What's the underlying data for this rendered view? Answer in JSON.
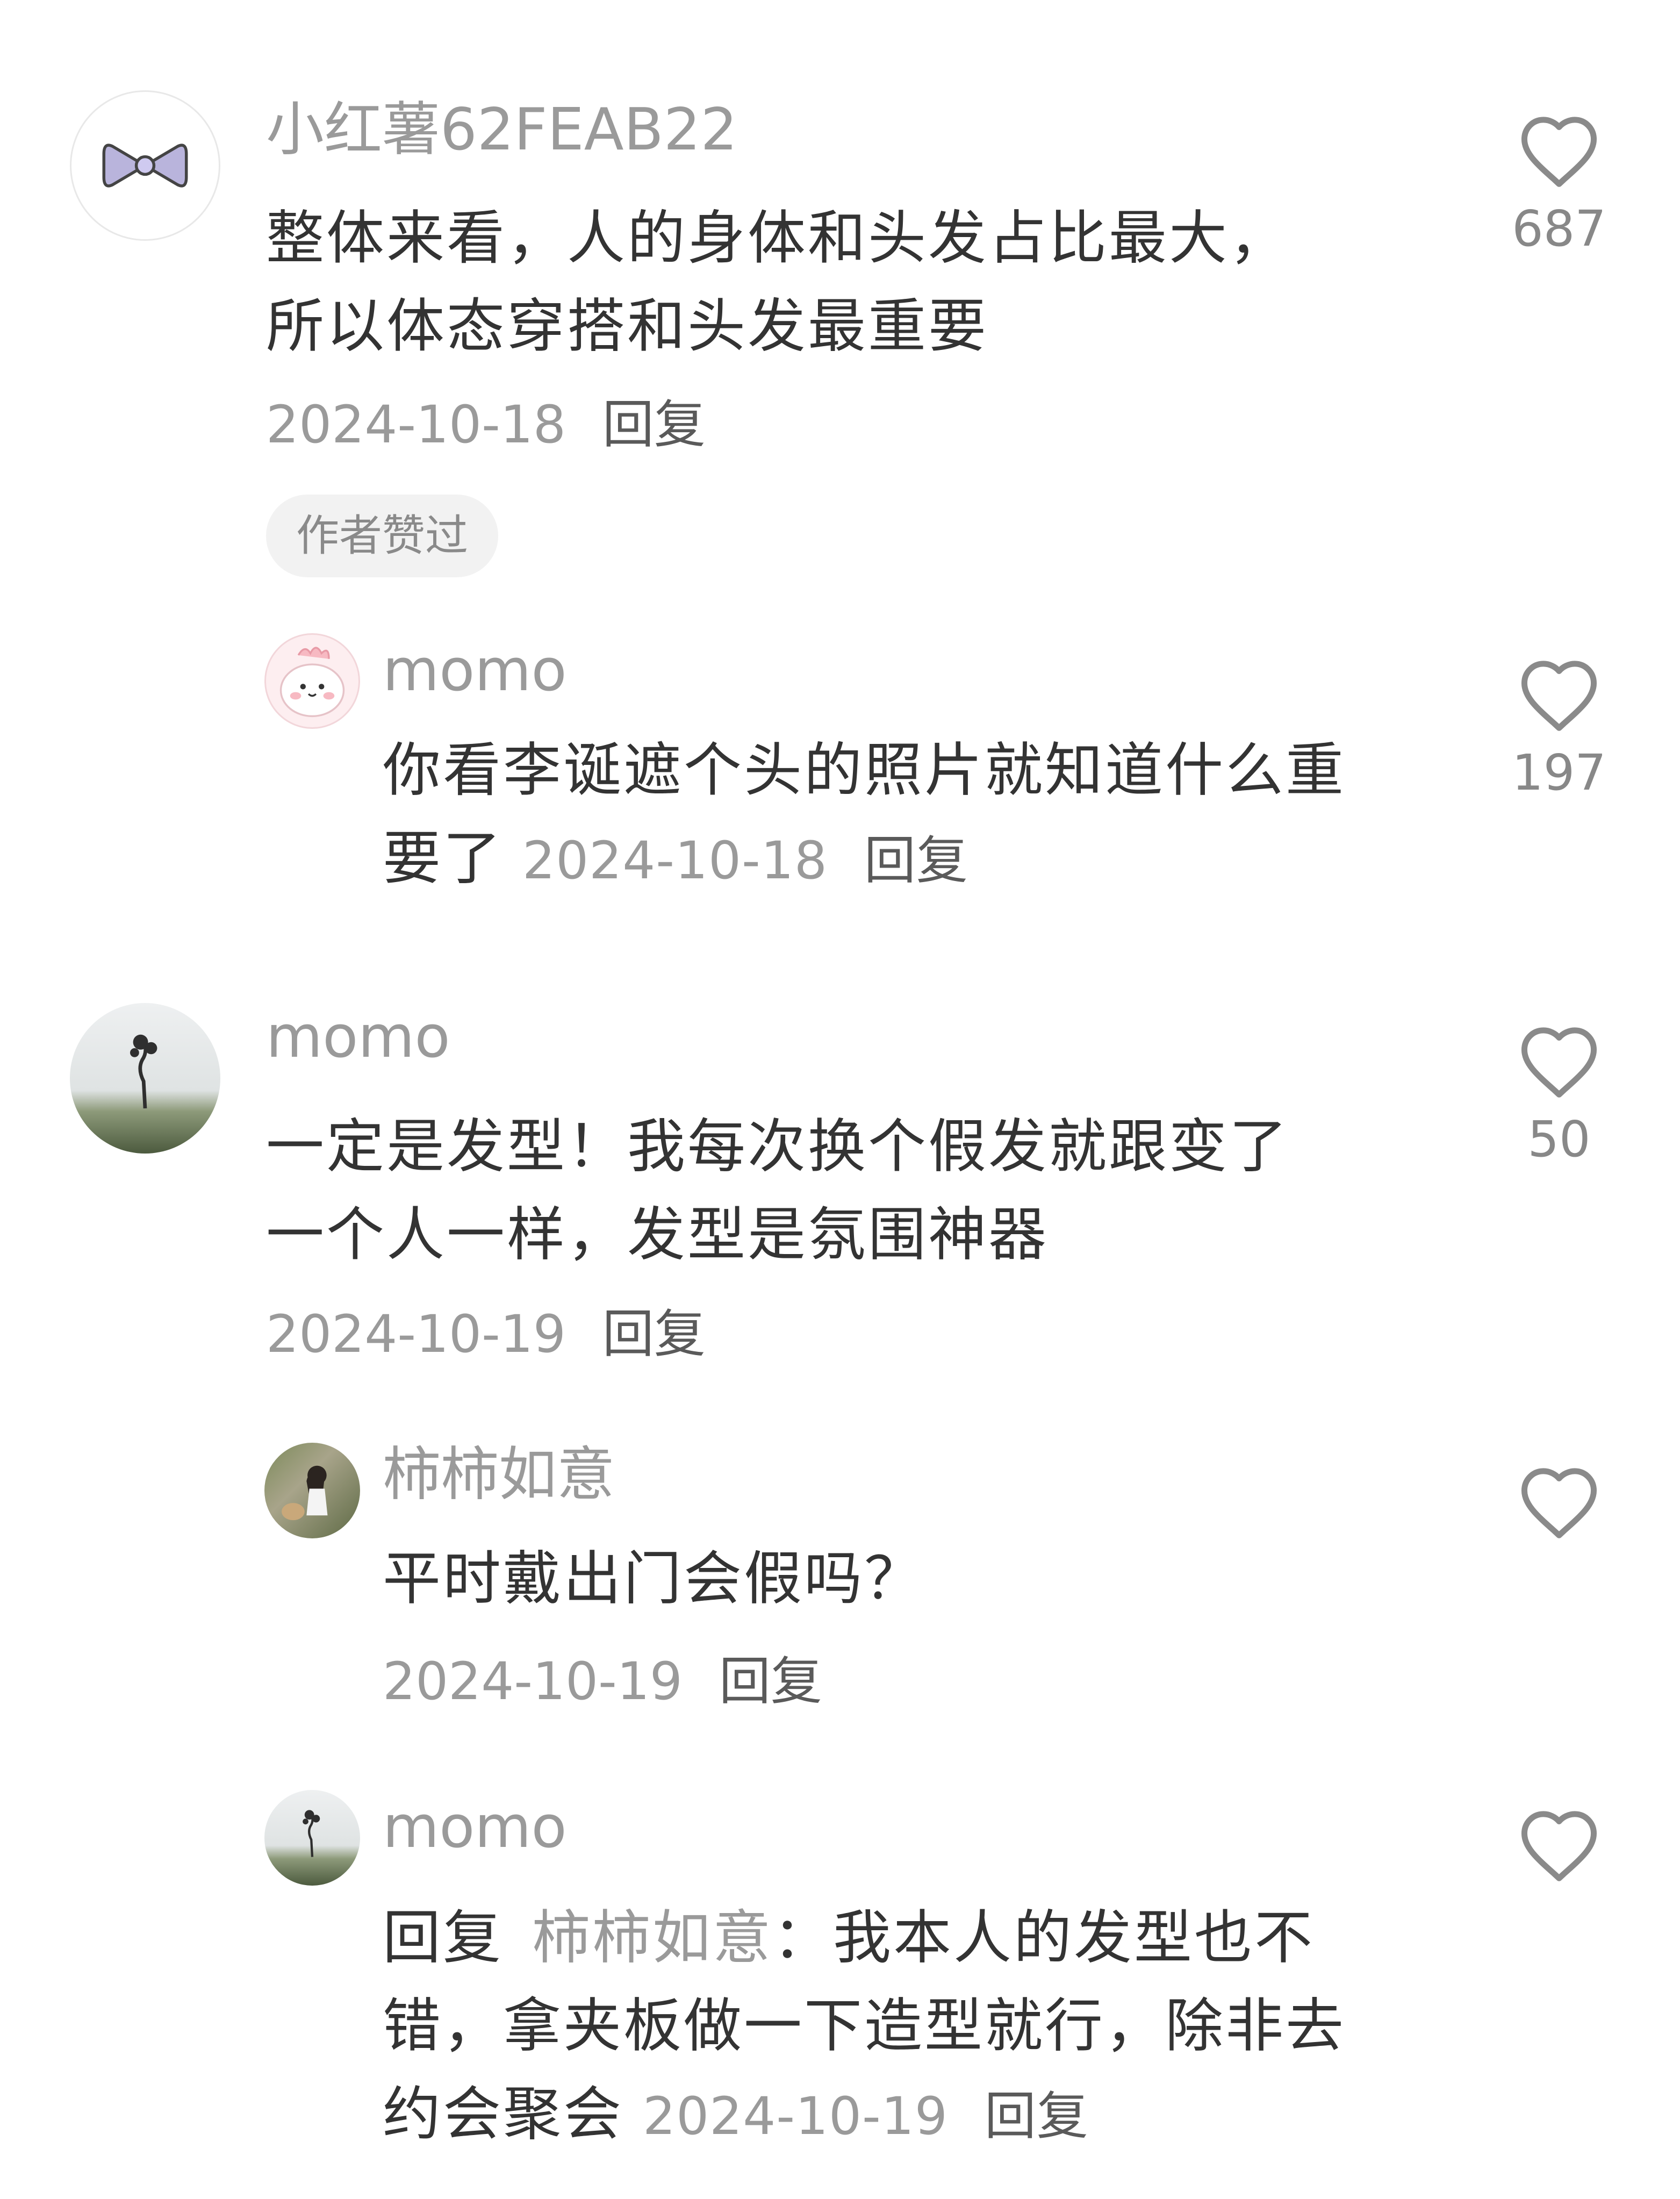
{
  "comments": [
    {
      "username": "小红薯62FEAB22",
      "avatar": "bow-avatar",
      "text_line1": "整体来看，人的身体和头发占比最大，",
      "text_line2": "所以体态穿搭和头发最重要",
      "date": "2024-10-18",
      "reply_label": "回复",
      "likes": "687",
      "badge": "作者赞过"
    },
    {
      "username": "momo",
      "avatar": "pink-cartoon-avatar",
      "text_line1": "你看李诞遮个头的照片就知道什么重",
      "text_line2": "要了",
      "date": "2024-10-18",
      "reply_label": "回复",
      "likes": "197"
    },
    {
      "username": "momo",
      "avatar": "tree-landscape-avatar",
      "text_line1": "一定是发型！我每次换个假发就跟变了",
      "text_line2": "一个人一样，发型是氛围神器",
      "date": "2024-10-19",
      "reply_label": "回复",
      "likes": "50"
    },
    {
      "username": "柿柿如意",
      "avatar": "girl-photo-avatar",
      "text_line1": "平时戴出门会假吗？",
      "date": "2024-10-19",
      "reply_label": "回复",
      "likes": ""
    },
    {
      "username": "momo",
      "avatar": "tree-landscape-avatar",
      "reply_prefix": "回复",
      "reply_to": "柿柿如意",
      "reply_colon": "：",
      "text_line1": "我本人的发型也不",
      "text_line2": "错，拿夹板做一下造型就行，除非去",
      "text_line3": "约会聚会",
      "date": "2024-10-19",
      "reply_label": "回复",
      "likes": ""
    }
  ],
  "colors": {
    "text": "#333333",
    "secondary": "#9a9a9a",
    "badge_bg": "#f2f2f2",
    "icon": "#8a8a8a"
  }
}
